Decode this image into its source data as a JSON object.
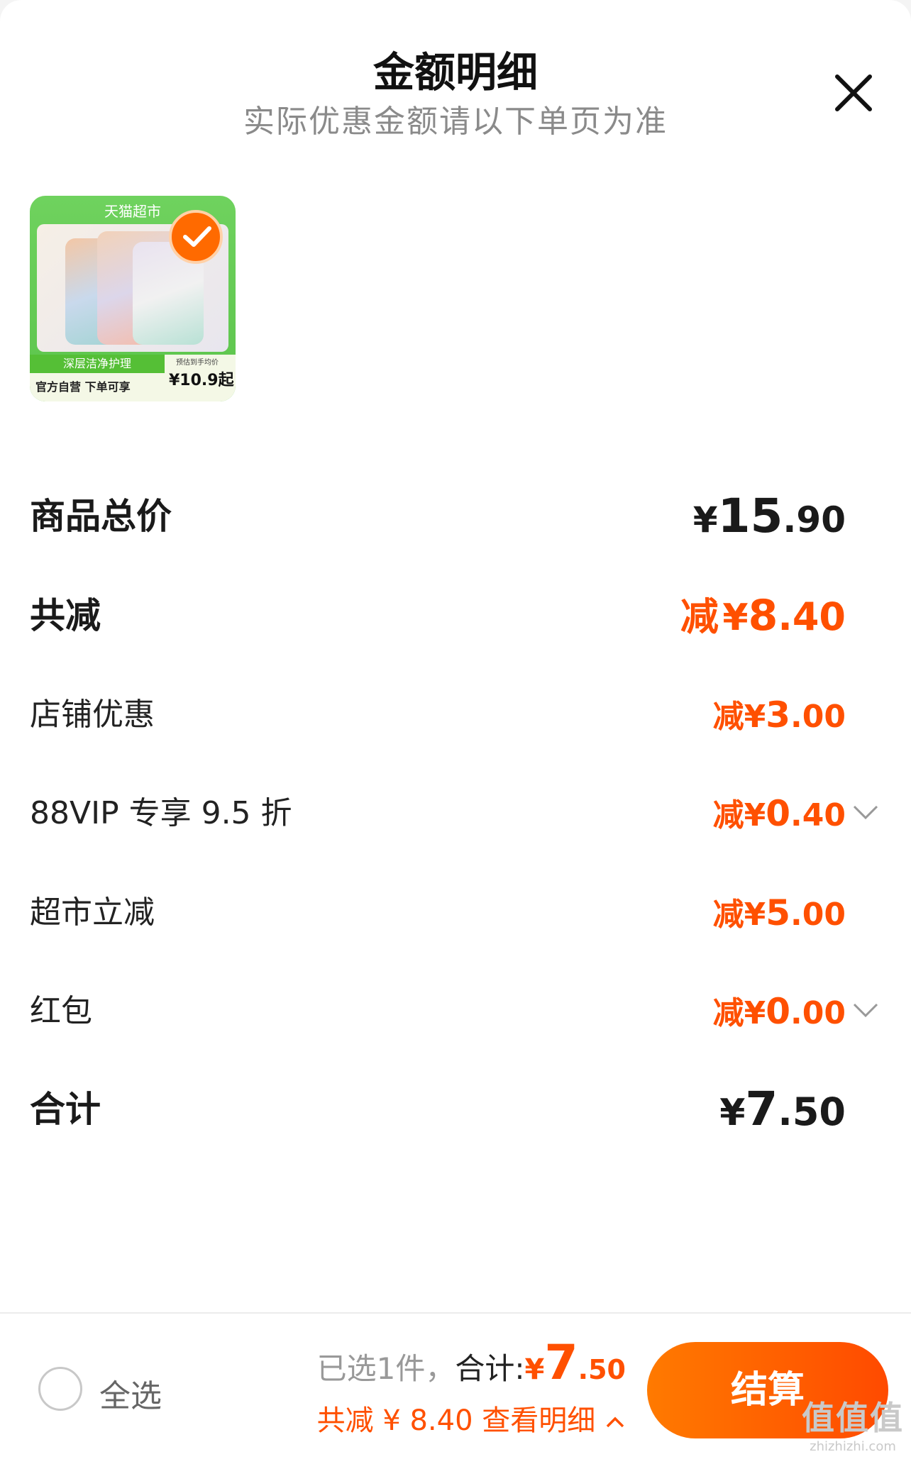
{
  "header": {
    "title": "金额明细",
    "subtitle": "实际优惠金额请以下单页为准"
  },
  "product": {
    "store_banner": "天猫超市",
    "label_left": "深层洁净护理",
    "label_bottom": "官方自营 下单可享",
    "price_note": "预估到手均价",
    "price": "¥10.9起"
  },
  "rows": [
    {
      "label": "商品总价",
      "prefix": "",
      "currency": "¥",
      "int": "15",
      "dec": ".90"
    },
    {
      "label": "共减",
      "prefix": "减",
      "currency": "¥",
      "int": "8",
      "dec": ".40"
    },
    {
      "label": "店铺优惠",
      "prefix": "减",
      "currency": "¥",
      "int": "3",
      "dec": ".00"
    },
    {
      "label": "88VIP 专享 9.5 折",
      "prefix": "减",
      "currency": "¥",
      "int": "0",
      "dec": ".40"
    },
    {
      "label": "超市立减",
      "prefix": "减",
      "currency": "¥",
      "int": "5",
      "dec": ".00"
    },
    {
      "label": "红包",
      "prefix": "减",
      "currency": "¥",
      "int": "0",
      "dec": ".00"
    },
    {
      "label": "合计",
      "prefix": "",
      "currency": "¥",
      "int": "7",
      "dec": ".50"
    }
  ],
  "bottom": {
    "select_all": "全选",
    "selected": "已选1件，",
    "total_label": "合计:",
    "currency": "¥",
    "total_int": "7",
    "total_dec": ".50",
    "discount_text": "共减 ¥ 8.40",
    "view_detail": "查看明细",
    "checkout": "结算"
  },
  "watermark": {
    "main": "值值值",
    "sub": "zhizhizhi.com"
  },
  "colors": {
    "accent": "#ff5000",
    "checkout_start": "#ff7a00",
    "checkout_end": "#ff4a00"
  },
  "icons": [
    "close-icon",
    "checkmark-icon",
    "chevron-down-icon",
    "chevron-up-icon"
  ]
}
